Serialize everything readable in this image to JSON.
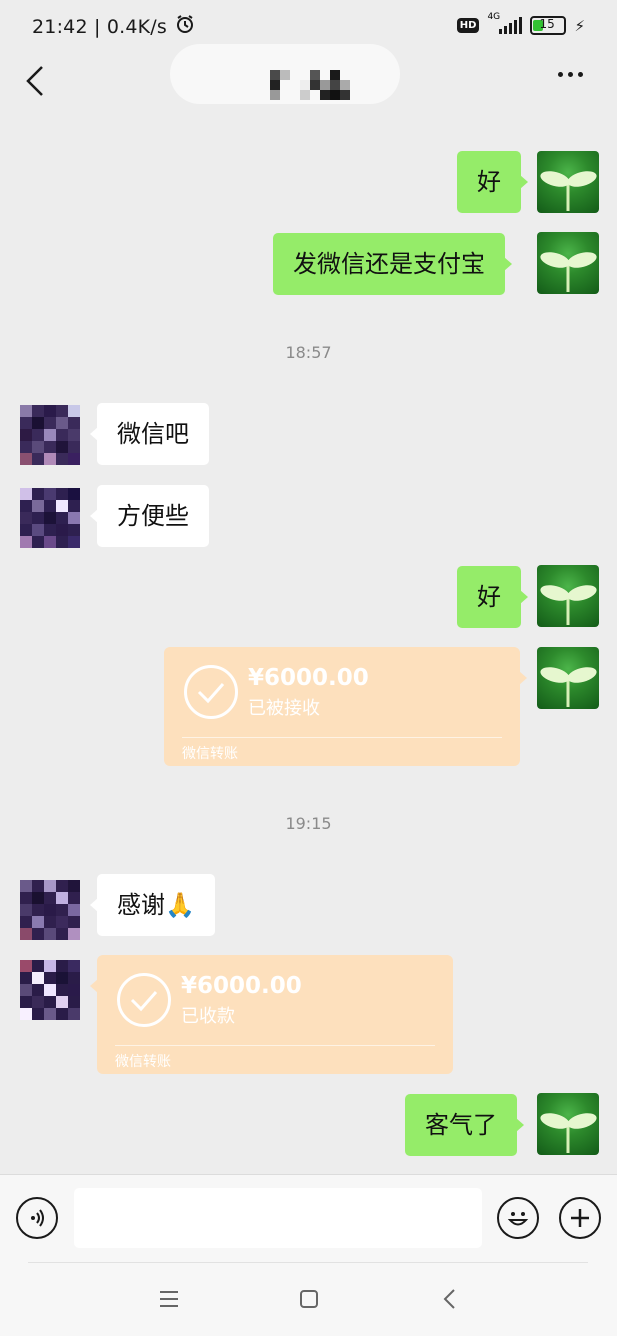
{
  "status_bar": {
    "time_speed": "21:42 | 0.4K/s",
    "hd": "HD",
    "network": "4G",
    "battery": "15"
  },
  "messages": {
    "m1": "好",
    "m2": "发微信还是支付宝",
    "time1": "18:57",
    "m3": "微信吧",
    "m4": "方便些",
    "m5": "好",
    "transfer1": {
      "amount": "¥6000.00",
      "status": "已被接收",
      "label": "微信转账"
    },
    "time2": "19:15",
    "m6": "感谢🙏",
    "transfer2": {
      "amount": "¥6000.00",
      "status": "已收款",
      "label": "微信转账"
    },
    "m7": "客气了"
  },
  "colors": {
    "my_bubble": "#95ec69",
    "their_bubble": "#ffffff",
    "transfer_card": "#fde0bd",
    "background": "#ededed"
  },
  "icons": [
    "back-icon",
    "more-icon",
    "voice-icon",
    "emoji-icon",
    "add-icon",
    "alarm-icon",
    "charging-icon",
    "menu-nav-icon",
    "home-nav-icon",
    "back-nav-icon"
  ]
}
